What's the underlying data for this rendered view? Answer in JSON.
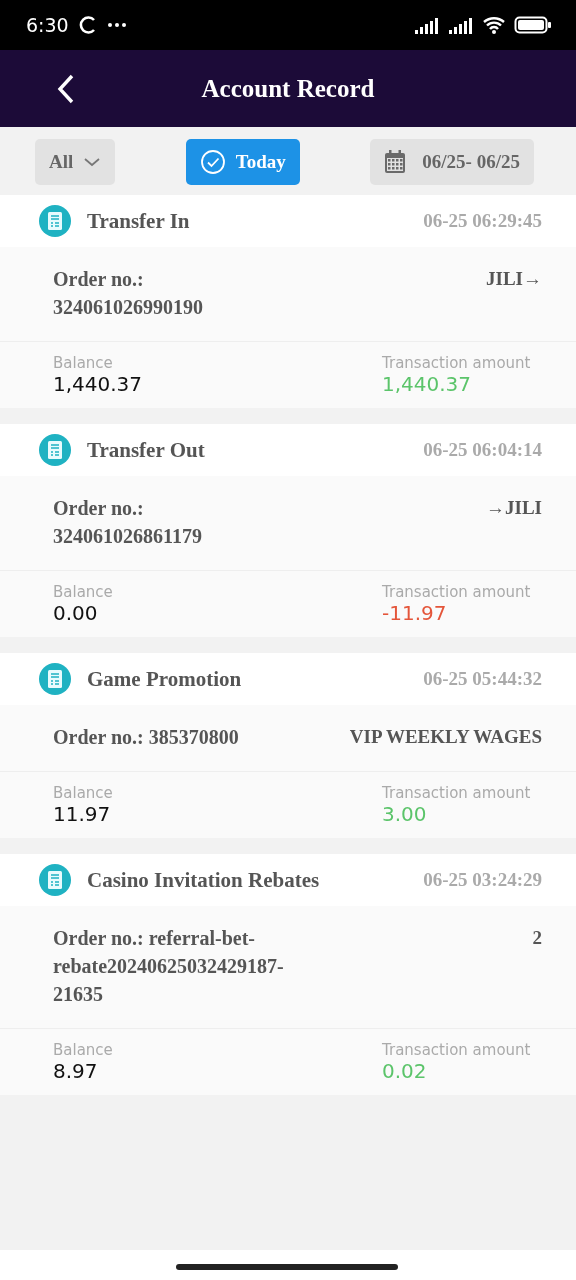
{
  "status_bar": {
    "time": "6:30"
  },
  "header": {
    "title": "Account Record"
  },
  "filters": {
    "type": {
      "label": "All"
    },
    "today": {
      "label": "Today",
      "selected": true
    },
    "date_range": {
      "label": "06/25- 06/25"
    }
  },
  "records": [
    {
      "title": "Transfer In",
      "time": "06-25 06:29:45",
      "order": "Order no.: 324061026990190",
      "target": "JILI→",
      "balance_label": "Balance",
      "balance": "1,440.37",
      "amount_label": "Transaction amount",
      "amount": "1,440.37",
      "kind": "credit"
    },
    {
      "title": "Transfer Out",
      "time": "06-25 06:04:14",
      "order": "Order no.: 324061026861179",
      "target": "→JILI",
      "balance_label": "Balance",
      "balance": "0.00",
      "amount_label": "Transaction amount",
      "amount": "-11.97",
      "kind": "debit"
    },
    {
      "title": "Game Promotion",
      "time": "06-25 05:44:32",
      "order": "Order no.: 385370800",
      "target": "VIP WEEKLY WAGES",
      "balance_label": "Balance",
      "balance": "11.97",
      "amount_label": "Transaction amount",
      "amount": "3.00",
      "kind": "credit"
    },
    {
      "title": "Casino Invitation Rebates",
      "time": "06-25 03:24:29",
      "order": "Order no.: referral-bet-rebate20240625032429187-21635",
      "target": "2",
      "balance_label": "Balance",
      "balance": "8.97",
      "amount_label": "Transaction amount",
      "amount": "0.02",
      "kind": "credit"
    }
  ]
}
